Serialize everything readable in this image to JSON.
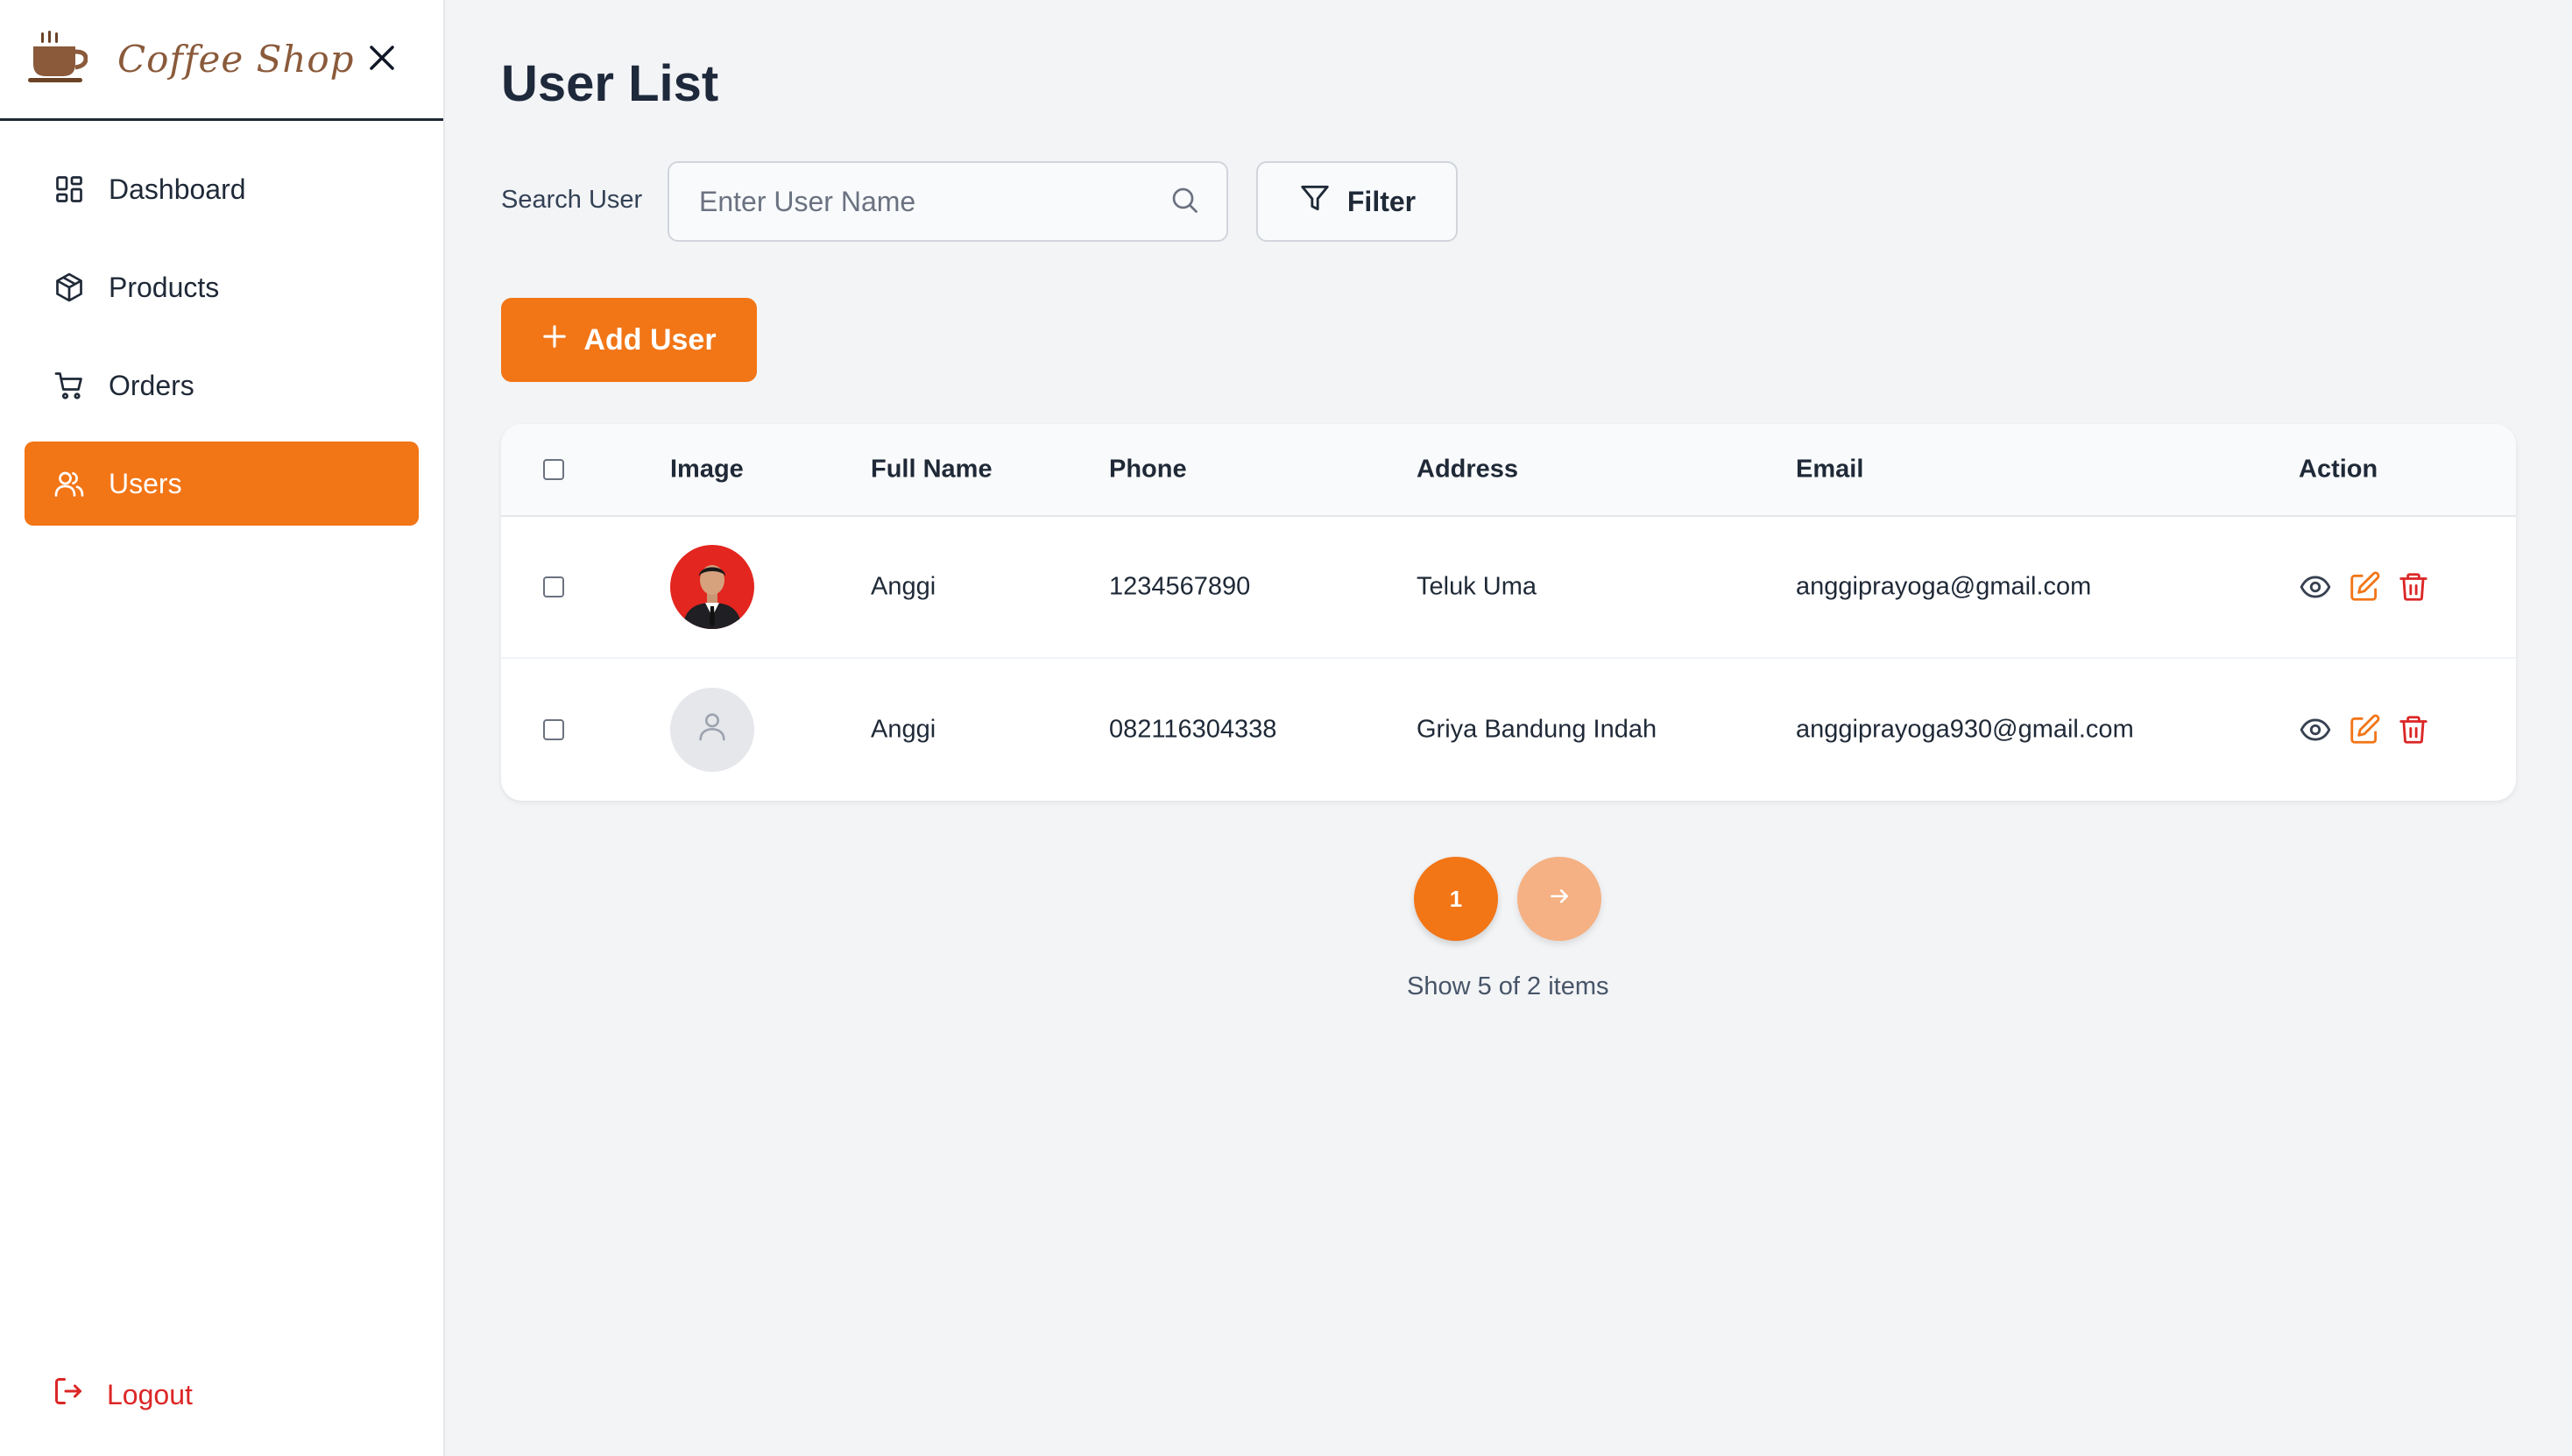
{
  "brand": {
    "name": "Coffee Shop",
    "logo_icon": "coffee-cup-icon"
  },
  "sidebar": {
    "items": [
      {
        "label": "Dashboard",
        "icon": "dashboard-grid-icon",
        "active": false
      },
      {
        "label": "Products",
        "icon": "box-icon",
        "active": false
      },
      {
        "label": "Orders",
        "icon": "cart-icon",
        "active": false
      },
      {
        "label": "Users",
        "icon": "users-icon",
        "active": true
      }
    ],
    "logout_label": "Logout"
  },
  "main": {
    "title": "User List",
    "search": {
      "label": "Search User",
      "placeholder": "Enter User Name",
      "value": ""
    },
    "filter_label": "Filter",
    "add_user_label": "Add User",
    "table": {
      "headers": [
        "Image",
        "Full Name",
        "Phone",
        "Address",
        "Email",
        "Action"
      ],
      "rows": [
        {
          "image": "photo",
          "full_name": "Anggi",
          "phone": "1234567890",
          "address": "Teluk Uma",
          "email": "anggiprayoga@gmail.com"
        },
        {
          "image": "placeholder",
          "full_name": "Anggi",
          "phone": "082116304338",
          "address": "Griya Bandung Indah",
          "email": "anggiprayoga930@gmail.com"
        }
      ]
    },
    "pagination": {
      "current_page": "1",
      "info": "Show 5 of 2 items"
    }
  },
  "colors": {
    "accent": "#f27516",
    "accent_light": "#f5b183",
    "danger": "#dc2626",
    "sidebar_bg": "#ffffff",
    "page_bg": "#f3f4f6"
  }
}
